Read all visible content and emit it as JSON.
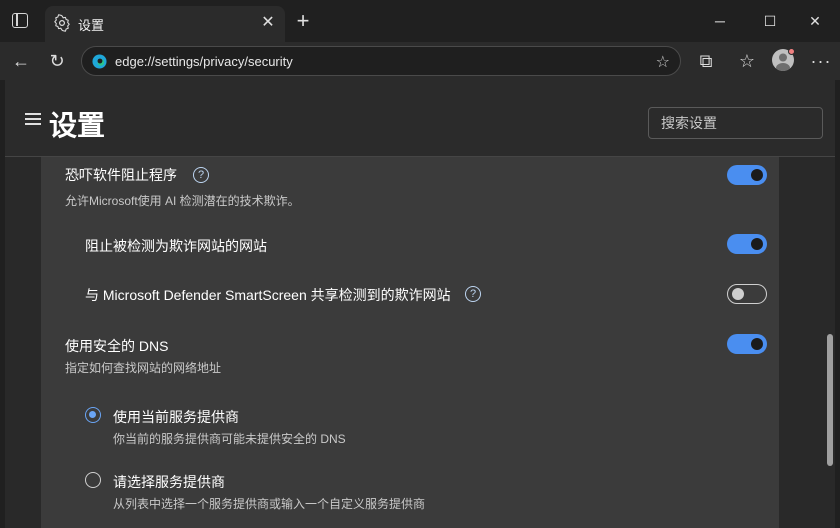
{
  "tab": {
    "title": "设置",
    "close": "✕"
  },
  "new_tab": "+",
  "window": {
    "minimize": "─",
    "maximize": "☐",
    "close": "✕"
  },
  "toolbar": {
    "back": "←",
    "refresh": "↻",
    "extensions": "⧉",
    "favorites": "☆"
  },
  "address": {
    "url": "edge://settings/privacy/security",
    "star": "☆"
  },
  "page": {
    "title": "设置",
    "search_placeholder": "搜索设置"
  },
  "settings": {
    "scareware": {
      "title": "恐吓软件阻止程序",
      "desc": "允许Microsoft使用 AI 检测潜在的技术欺诈。",
      "help": "?",
      "enabled": true
    },
    "block_scam_sites": {
      "title": "阻止被检测为欺诈网站的网站",
      "enabled": true
    },
    "share_smartscreen": {
      "title": "与 Microsoft Defender SmartScreen 共享检测到的欺诈网站",
      "help": "?",
      "enabled": false
    },
    "secure_dns": {
      "title": "使用安全的 DNS",
      "desc": "指定如何查找网站的网络地址",
      "enabled": true
    },
    "dns_current": {
      "title": "使用当前服务提供商",
      "desc": "你当前的服务提供商可能未提供安全的 DNS",
      "selected": true
    },
    "dns_choose": {
      "title": "请选择服务提供商",
      "desc": "从列表中选择一个服务提供商或输入一个自定义服务提供商",
      "selected": false
    }
  },
  "colors": {
    "accent": "#4a8ef0",
    "background": "#202020",
    "card": "#3b3b3b"
  }
}
